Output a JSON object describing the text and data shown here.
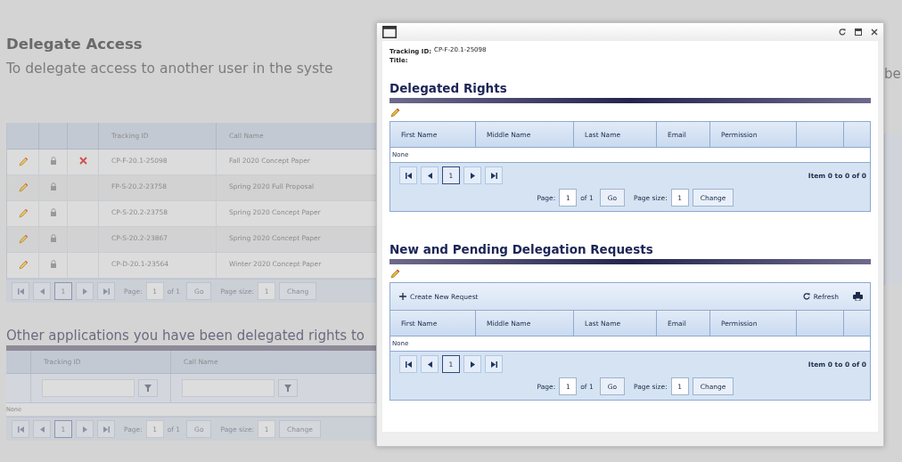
{
  "page": {
    "heading": "Delegate Access",
    "intro": "To delegate access to another user in the syste",
    "intro_tail": "be"
  },
  "applications_table": {
    "columns": [
      "Tracking ID",
      "Call Name"
    ],
    "rows": [
      {
        "tracking_id": "CP-F-20.1-25098",
        "call_name": "Fall 2020 Concept Paper",
        "deletable": true
      },
      {
        "tracking_id": "FP-S-20.2-23758",
        "call_name": "Spring 2020 Full Proposal",
        "deletable": false
      },
      {
        "tracking_id": "CP-S-20.2-23758",
        "call_name": "Spring 2020 Concept Paper",
        "deletable": false
      },
      {
        "tracking_id": "CP-S-20.2-23867",
        "call_name": "Spring 2020 Concept Paper",
        "deletable": false
      },
      {
        "tracking_id": "CP-D-20.1-23564",
        "call_name": "Winter 2020 Concept Paper",
        "deletable": false
      }
    ],
    "pager": {
      "pages": [
        {
          "label": "1",
          "selected": true
        }
      ],
      "page_label": "Page:",
      "page_value": "1",
      "of_text": "of 1",
      "go": "Go",
      "size_label": "Page size:",
      "size_value": "1",
      "change": "Chang"
    }
  },
  "other_section": {
    "heading": "Other applications you have been delegated rights to",
    "columns": [
      "Tracking ID",
      "Call Name"
    ],
    "empty_text": "None",
    "pager": {
      "pages": [
        {
          "label": "1",
          "selected": true
        }
      ],
      "page_label": "Page:",
      "page_value": "1",
      "of_text": "of 1",
      "go": "Go",
      "size_label": "Page size:",
      "size_value": "1",
      "change": "Change"
    }
  },
  "dialog": {
    "tracking_label": "Tracking ID:",
    "tracking_value": "CP-F-20.1-25098",
    "title_label": "Title:",
    "sections": [
      {
        "heading": "Delegated Rights",
        "columns": [
          "First Name",
          "Middle Name",
          "Last Name",
          "Email",
          "Permission"
        ],
        "empty_text": "None",
        "pager": {
          "pages": [
            {
              "label": "1",
              "selected": true
            }
          ],
          "summary": "Item 0 to 0 of 0",
          "page_label": "Page:",
          "page_value": "1",
          "of_text": "of 1",
          "go": "Go",
          "size_label": "Page size:",
          "size_value": "1",
          "change": "Change"
        }
      },
      {
        "heading": "New and Pending Delegation Requests",
        "toolbar": {
          "create": "Create New Request",
          "refresh": "Refresh"
        },
        "columns": [
          "First Name",
          "Middle Name",
          "Last Name",
          "Email",
          "Permission"
        ],
        "empty_text": "None",
        "pager": {
          "pages": [
            {
              "label": "1",
              "selected": true
            }
          ],
          "summary": "Item 0 to 0 of 0",
          "page_label": "Page:",
          "page_value": "1",
          "of_text": "of 1",
          "go": "Go",
          "size_label": "Page size:",
          "size_value": "1",
          "change": "Change"
        }
      }
    ]
  }
}
